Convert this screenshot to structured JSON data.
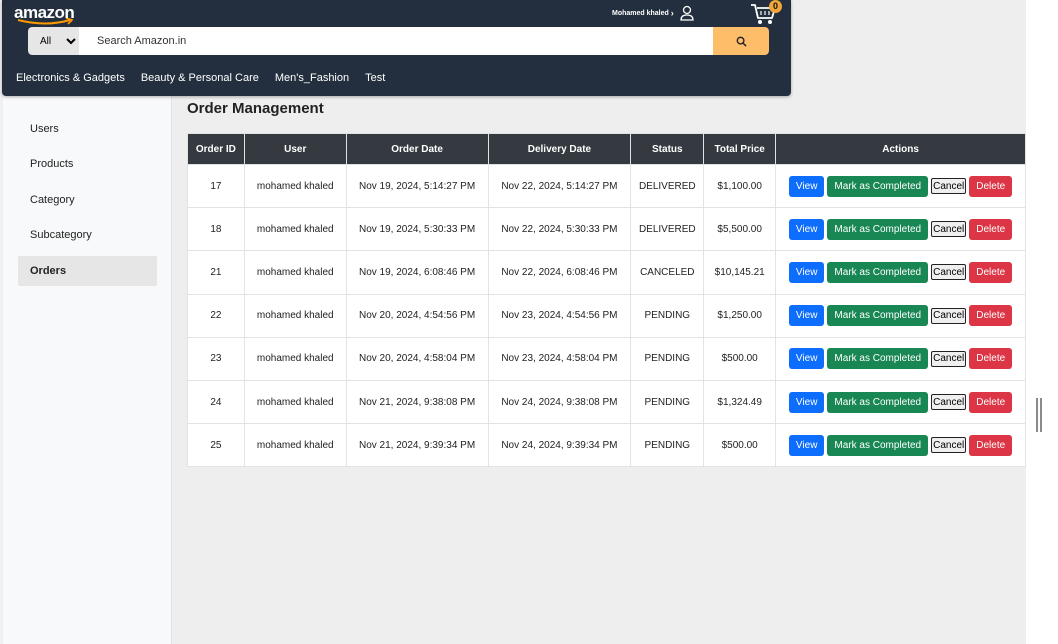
{
  "nav": {
    "logo": "amazon",
    "user_name": "Mohamed khaled",
    "cart_count": "0",
    "search_category": "All",
    "search_placeholder": "Search Amazon.in",
    "categories": [
      "Electronics & Gadgets",
      "Beauty & Personal Care",
      "Men's_Fashion",
      "Test"
    ]
  },
  "sidebar": {
    "items": [
      "Users",
      "Products",
      "Category",
      "Subcategory",
      "Orders"
    ],
    "active": "Orders"
  },
  "page": {
    "title": "Order Management"
  },
  "table": {
    "headers": [
      "Order ID",
      "User",
      "Order Date",
      "Delivery Date",
      "Status",
      "Total Price",
      "Actions"
    ],
    "actions": {
      "view": "View",
      "complete": "Mark as Completed",
      "cancel": "Cancel",
      "delete": "Delete"
    },
    "rows": [
      {
        "id": "17",
        "user": "mohamed khaled",
        "order_date": "Nov 19, 2024, 5:14:27 PM",
        "delivery_date": "Nov 22, 2024, 5:14:27 PM",
        "status": "DELIVERED",
        "total": "$1,100.00"
      },
      {
        "id": "18",
        "user": "mohamed khaled",
        "order_date": "Nov 19, 2024, 5:30:33 PM",
        "delivery_date": "Nov 22, 2024, 5:30:33 PM",
        "status": "DELIVERED",
        "total": "$5,500.00"
      },
      {
        "id": "21",
        "user": "mohamed khaled",
        "order_date": "Nov 19, 2024, 6:08:46 PM",
        "delivery_date": "Nov 22, 2024, 6:08:46 PM",
        "status": "CANCELED",
        "total": "$10,145.21"
      },
      {
        "id": "22",
        "user": "mohamed khaled",
        "order_date": "Nov 20, 2024, 4:54:56 PM",
        "delivery_date": "Nov 23, 2024, 4:54:56 PM",
        "status": "PENDING",
        "total": "$1,250.00"
      },
      {
        "id": "23",
        "user": "mohamed khaled",
        "order_date": "Nov 20, 2024, 4:58:04 PM",
        "delivery_date": "Nov 23, 2024, 4:58:04 PM",
        "status": "PENDING",
        "total": "$500.00"
      },
      {
        "id": "24",
        "user": "mohamed khaled",
        "order_date": "Nov 21, 2024, 9:38:08 PM",
        "delivery_date": "Nov 24, 2024, 9:38:08 PM",
        "status": "PENDING",
        "total": "$1,324.49"
      },
      {
        "id": "25",
        "user": "mohamed khaled",
        "order_date": "Nov 21, 2024, 9:39:34 PM",
        "delivery_date": "Nov 24, 2024, 9:39:34 PM",
        "status": "PENDING",
        "total": "$500.00"
      }
    ]
  },
  "colors": {
    "navbar": "#232f3e",
    "search_button": "#febd69",
    "view": "#0d6efd",
    "complete": "#198754",
    "delete": "#dc3545",
    "table_header": "#343a40"
  },
  "icons": [
    "search-icon",
    "user-icon",
    "cart-icon",
    "chevron-right-icon"
  ]
}
